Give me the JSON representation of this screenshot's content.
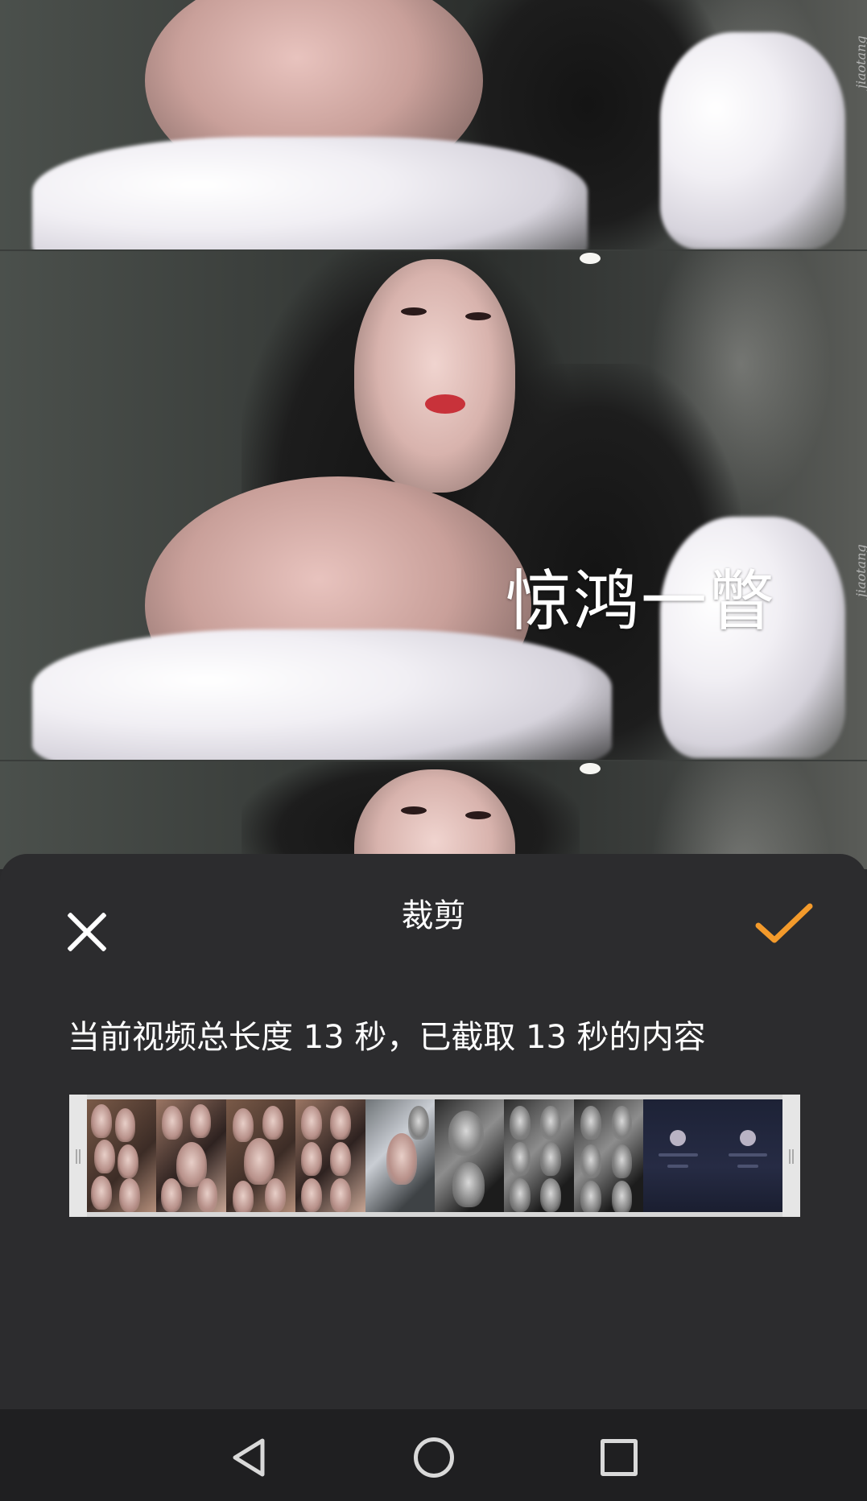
{
  "preview": {
    "caption_overlay": "惊鸿一瞥",
    "watermark": "jiaotang"
  },
  "crop_sheet": {
    "title": "裁剪",
    "close_icon": "close-icon",
    "confirm_icon": "checkmark-icon",
    "info_text": "当前视频总长度 13 秒，已截取 13 秒的内容",
    "total_length_seconds": 13,
    "selected_length_seconds": 13
  },
  "timeline": {
    "frame_count": 10
  },
  "navbar": {
    "back_icon": "back-triangle-icon",
    "home_icon": "home-circle-icon",
    "recent_icon": "recent-apps-square-icon"
  },
  "colors": {
    "sheet_background": "#2c2c2e",
    "confirm_accent": "#f39a2b",
    "text": "#ffffff",
    "navbar_background": "#1f1f21"
  }
}
